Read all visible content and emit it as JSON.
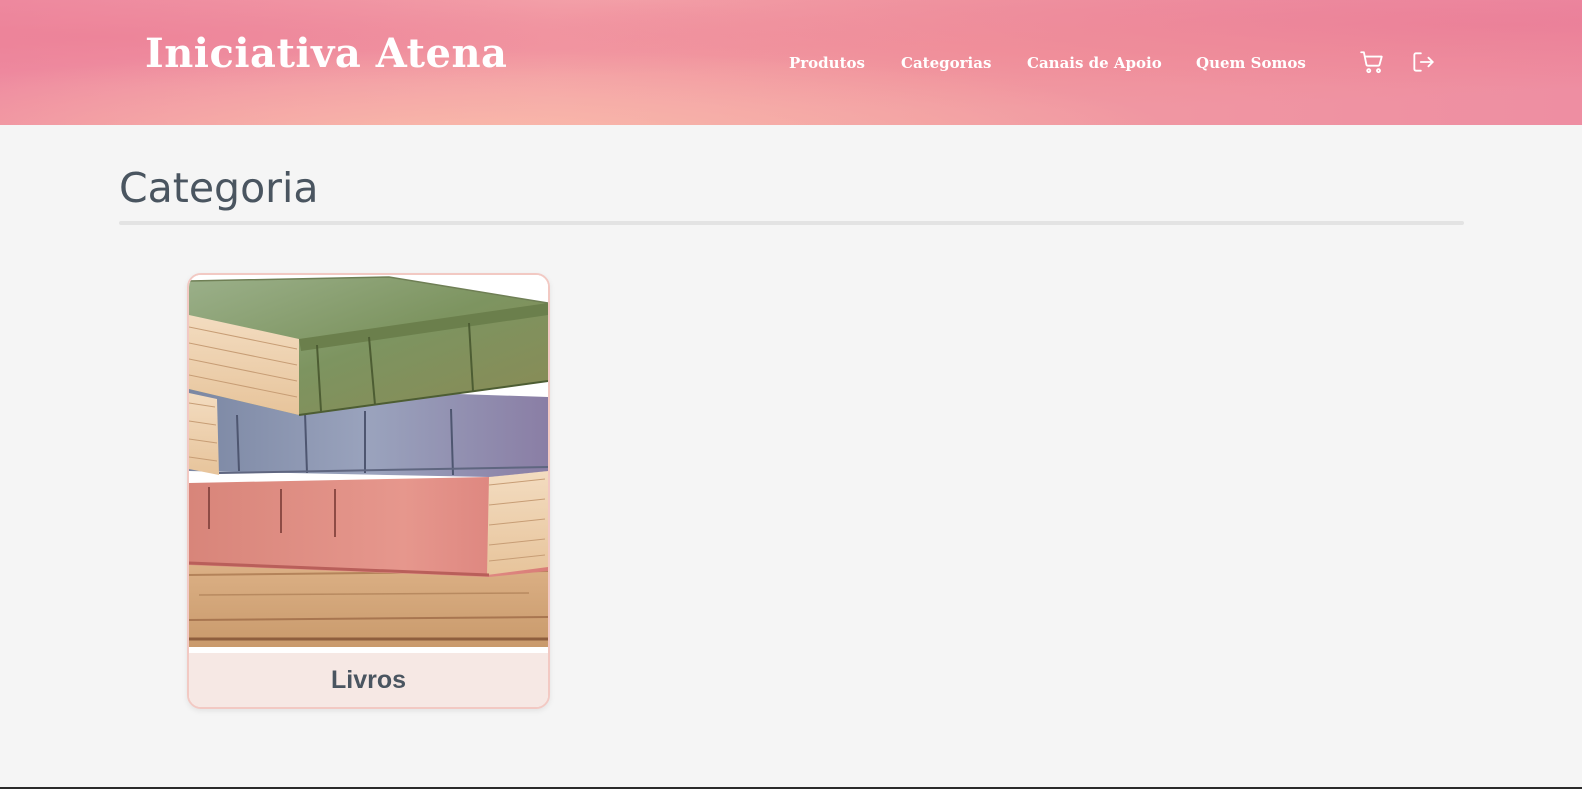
{
  "header": {
    "brand": "Iniciativa Atena",
    "nav": [
      {
        "label": "Produtos"
      },
      {
        "label": "Categorias"
      },
      {
        "label": "Canais de Apoio"
      },
      {
        "label": "Quem Somos"
      }
    ],
    "icons": [
      "cart-icon",
      "logout-icon"
    ]
  },
  "main": {
    "title": "Categoria",
    "categories": [
      {
        "label": "Livros",
        "image": "stacked-books-watercolor"
      }
    ]
  },
  "colors": {
    "header_pink": "#f19aa2",
    "text_dark": "#4a5560",
    "card_border": "#f2c9c3",
    "card_footer": "#f6e8e4",
    "background": "#f5f5f5"
  }
}
